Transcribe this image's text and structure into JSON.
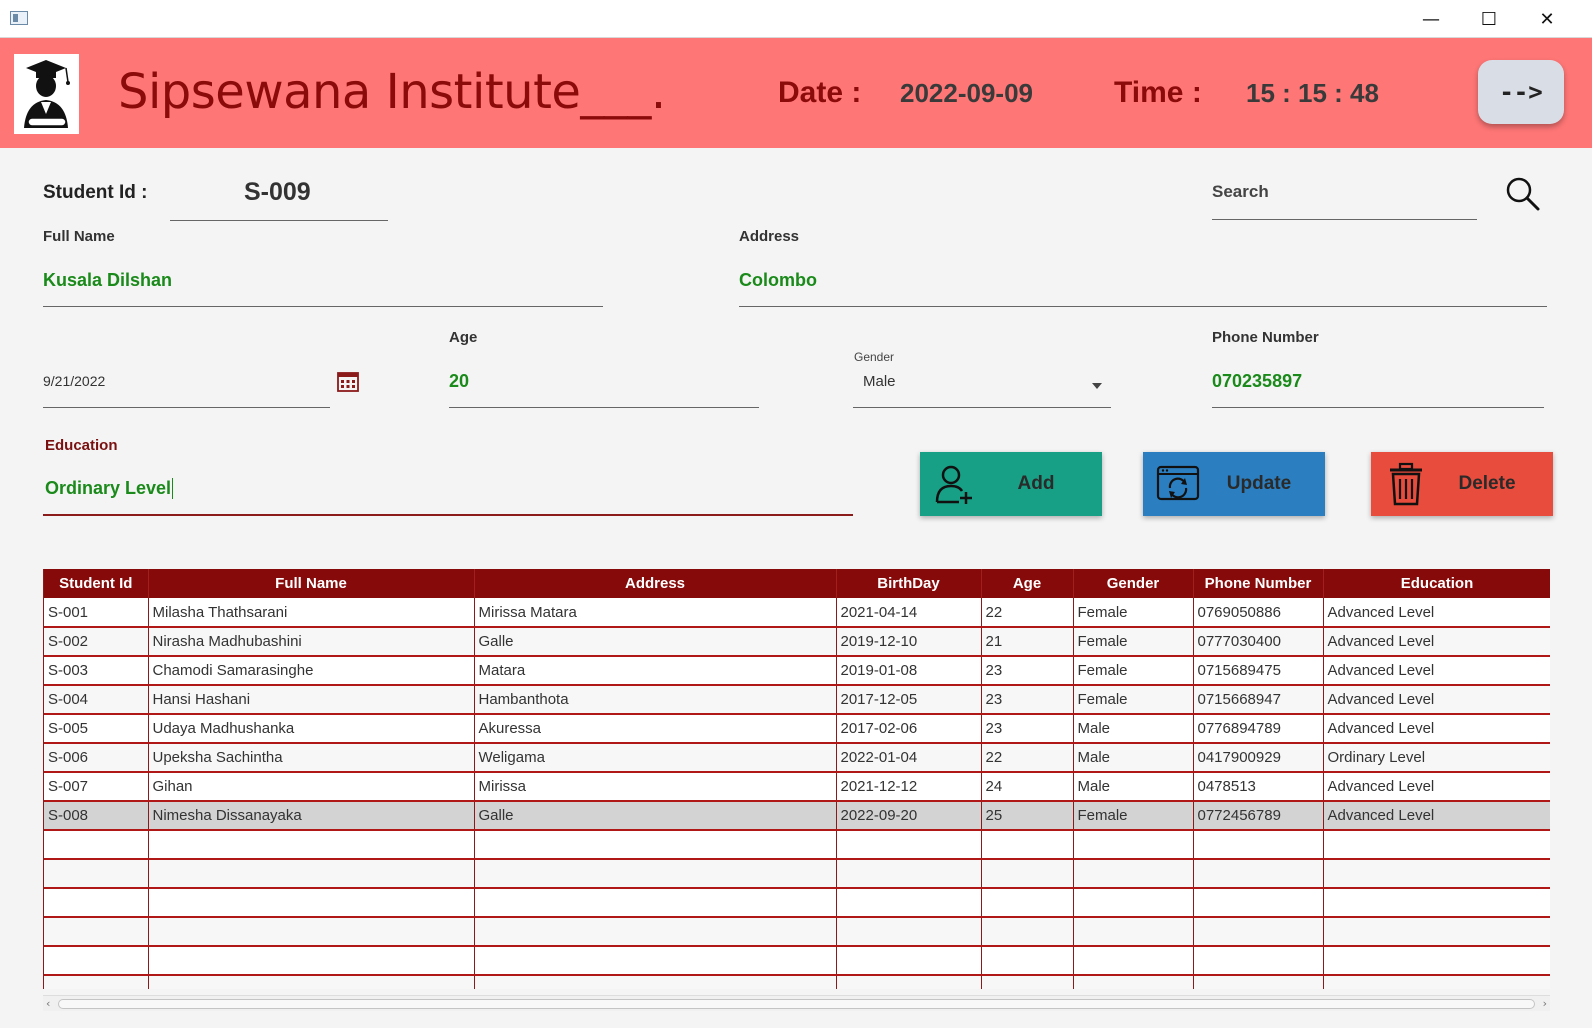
{
  "window": {
    "minimize": "—",
    "maximize": "☐",
    "close": "✕"
  },
  "header": {
    "brand": "Sipsewana Institute___.",
    "date_label": "Date :",
    "date_value": "2022-09-09",
    "time_label": "Time :",
    "time_value": "15 : 15 : 48",
    "nav_button": "-->",
    "background_color": "#ff7676",
    "accent_color": "#8b0a0a"
  },
  "form": {
    "student_id_label": "Student Id :",
    "student_id_value": "S-009",
    "search_placeholder": "Search",
    "full_name_label": "Full Name",
    "full_name_value": "Kusala Dilshan",
    "address_label": "Address",
    "address_value": "Colombo",
    "birthday_value": "9/21/2022",
    "age_label": "Age",
    "age_value": "20",
    "gender_label": "Gender",
    "gender_value": "Male",
    "phone_label": "Phone Number",
    "phone_value": "070235897",
    "education_label": "Education",
    "education_value": "Ordinary Level"
  },
  "actions": {
    "add": "Add",
    "update": "Update",
    "delete": "Delete",
    "add_color": "#17a085",
    "update_color": "#2b7fc0",
    "delete_color": "#e74c3c"
  },
  "table": {
    "columns": [
      "Student Id",
      "Full Name",
      "Address",
      "BirthDay",
      "Age",
      "Gender",
      "Phone Number",
      "Education"
    ],
    "rows": [
      [
        "S-001",
        "Milasha Thathsarani",
        "Mirissa Matara",
        "2021-04-14",
        "22",
        "Female",
        "0769050886",
        "Advanced Level"
      ],
      [
        "S-002",
        "Nirasha Madhubashini",
        "Galle",
        "2019-12-10",
        "21",
        "Female",
        "0777030400",
        "Advanced Level"
      ],
      [
        "S-003",
        "Chamodi Samarasinghe",
        "Matara",
        "2019-01-08",
        "23",
        "Female",
        "0715689475",
        "Advanced Level"
      ],
      [
        "S-004",
        "Hansi Hashani",
        "Hambanthota",
        "2017-12-05",
        "23",
        "Female",
        "0715668947",
        "Advanced Level"
      ],
      [
        "S-005",
        "Udaya Madhushanka",
        "Akuressa",
        "2017-02-06",
        "23",
        "Male",
        "0776894789",
        "Advanced Level"
      ],
      [
        "S-006",
        "Upeksha Sachintha",
        "Weligama",
        "2022-01-04",
        "22",
        "Male",
        "0417900929",
        "Ordinary Level"
      ],
      [
        "S-007",
        "Gihan",
        "Mirissa",
        "2021-12-12",
        "24",
        "Male",
        "0478513",
        "Advanced Level"
      ],
      [
        "S-008",
        "Nimesha Dissanayaka",
        "Galle",
        "2022-09-20",
        "25",
        "Female",
        "0772456789",
        "Advanced Level"
      ]
    ],
    "selected_row": 7,
    "empty_rows": 6
  },
  "scrollbar": {
    "left_arrow": "‹",
    "right_arrow": "›"
  }
}
